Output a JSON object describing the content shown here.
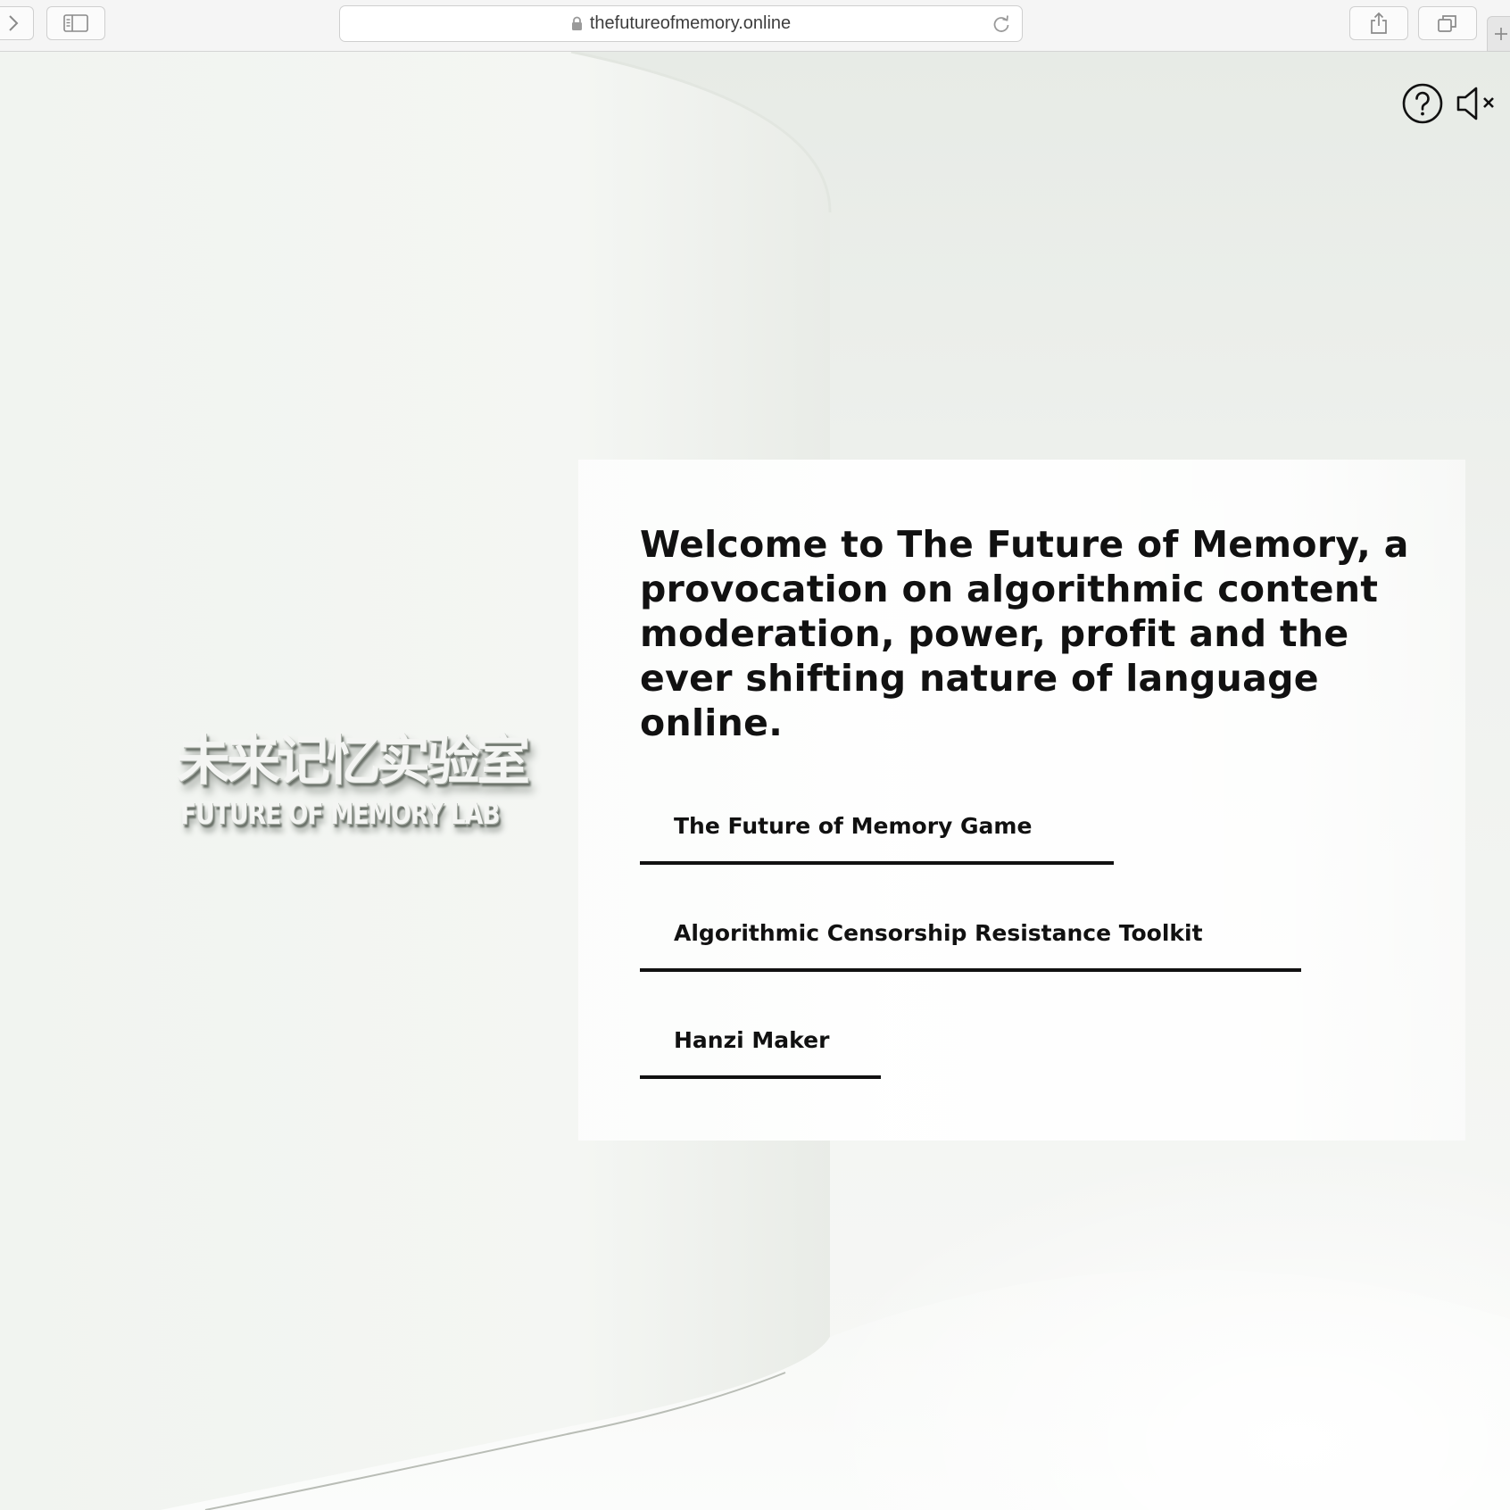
{
  "browser": {
    "url": "thefutureofmemory.online",
    "icons": {
      "forward": "chevron-right-icon",
      "sidebar": "sidebar-icon",
      "lock": "lock-icon",
      "reload": "reload-icon",
      "share": "share-icon",
      "tabs": "tabs-overview-icon",
      "new_tab": "plus-icon"
    }
  },
  "scene": {
    "wall_logo": {
      "chinese": "未来记忆实验室",
      "english": "FUTURE OF MEMORY LAB"
    }
  },
  "controls": {
    "help_icon": "question-circle-icon",
    "mute_icon": "speaker-muted-icon"
  },
  "welcome": {
    "title": "Welcome to The Future of Memory, a provocation on algorithmic content moderation, power, profit and the ever shifting nature of language online.",
    "links": [
      {
        "label": "The Future of Memory Game"
      },
      {
        "label": "Algorithmic Censorship Resistance Toolkit"
      },
      {
        "label": "Hanzi Maker"
      }
    ]
  },
  "colors": {
    "text": "#111111",
    "panel": "#ffffff",
    "scene_background": "#eef0ec",
    "toolbar": "#f5f5f5"
  }
}
